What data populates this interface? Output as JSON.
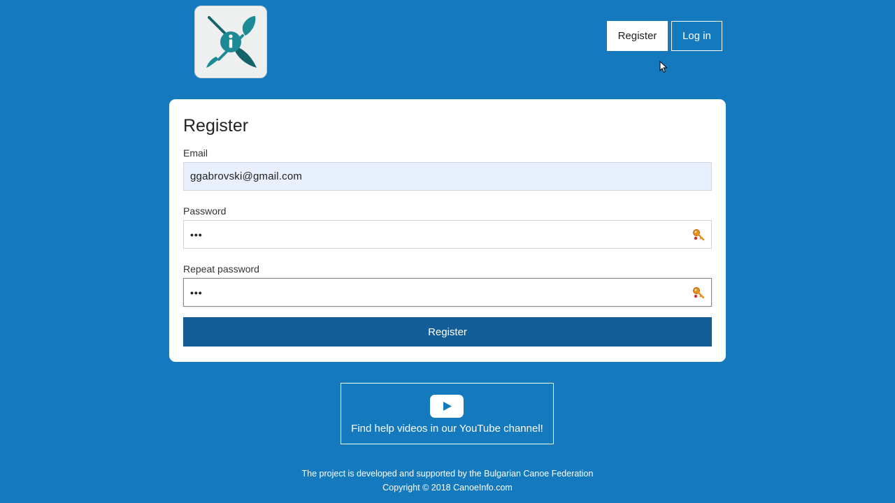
{
  "logo": {
    "icon": "canoe-info-logo-icon",
    "colors": {
      "teal": "#1e8a96",
      "dark_teal": "#13636b"
    }
  },
  "nav": {
    "register_label": "Register",
    "login_label": "Log in"
  },
  "form": {
    "title": "Register",
    "email": {
      "label": "Email",
      "value": "ggabrovski@gmail.com"
    },
    "password": {
      "label": "Password",
      "value": "•••",
      "icon": "key-icon"
    },
    "repeat_password": {
      "label": "Repeat password",
      "value": "•••",
      "icon": "key-icon"
    },
    "submit_label": "Register"
  },
  "youtube": {
    "icon": "youtube-play-icon",
    "text": "Find help videos in our YouTube channel!"
  },
  "footer": {
    "line1": "The project is developed and supported by the Bulgarian Canoe Federation",
    "line2": "Copyright © 2018 CanoeInfo.com"
  },
  "colors": {
    "background": "#1479bd",
    "primary_button": "#135e96",
    "autofill": "#e8f0fe"
  }
}
